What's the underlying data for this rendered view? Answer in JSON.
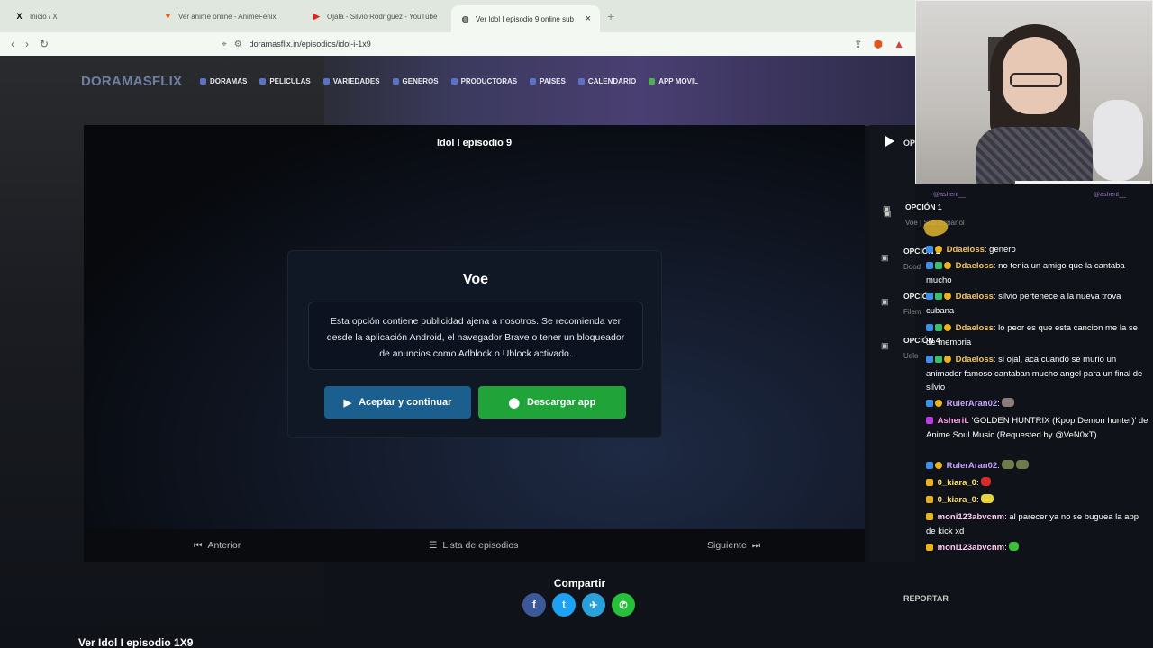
{
  "browser": {
    "tabs": [
      {
        "title": "Inicio / X",
        "icon": "x-logo-icon",
        "fav": "X",
        "favColor": "#000000"
      },
      {
        "title": "Ver anime online - AnimeFénix",
        "icon": "animefenix-icon",
        "fav": "▼",
        "favColor": "#e8601c"
      },
      {
        "title": "Ojalá - Silvio Rodríguez - YouTube",
        "icon": "youtube-icon",
        "fav": "▶",
        "favColor": "#e62117"
      },
      {
        "title": "Ver Idol I episodio 9 online sub",
        "icon": "globe-icon",
        "fav": "◍",
        "favColor": "#555555",
        "active": true
      }
    ],
    "newtab": "+",
    "close": "×",
    "url": "doramasflix.in/episodios/idol-i-1x9"
  },
  "site": {
    "logo": "DORAMASFLIX",
    "nav": [
      "DORAMAS",
      "PELICULAS",
      "VARIEDADES",
      "GENEROS",
      "PRODUCTORAS",
      "PAISES",
      "CALENDARIO",
      "APP MOVIL"
    ],
    "player_title": "Idol I episodio 9",
    "modal": {
      "title": "Voe",
      "text": "Esta opción contiene publicidad ajena a nosotros. Se recomienda ver desde la aplicación Android, el navegador Brave o tener un bloqueador de anuncios como Adblock o Ublock activado.",
      "accept": "Aceptar y continuar",
      "download": "Descargar app"
    },
    "footer": {
      "prev": "Anterior",
      "list": "Lista de episodios",
      "next": "Siguiente"
    },
    "options": [
      {
        "num": "OPCIÓN 1",
        "sub": "Voe | Sub Español"
      },
      {
        "num": "OPCIÓN 2",
        "sub": "Dood"
      },
      {
        "num": "OPCIÓN 3",
        "sub": "Filem"
      },
      {
        "num": "OPCIÓN 4",
        "sub": "Uqlo"
      }
    ],
    "op_label": "OP",
    "report": "REPORTAR",
    "share_title": "Compartir",
    "share": [
      "f",
      "t",
      "✈",
      "✆"
    ],
    "page_heading": "Ver Idol I episodio 1X9"
  },
  "chat": {
    "top_names": [
      "@asherit__",
      "@asherit__"
    ],
    "messages": [
      {
        "user": "Ddaeloss",
        "text": ": genero",
        "color": "ddael"
      },
      {
        "user": "Ddaeloss",
        "text": ": no tenia un amigo que la cantaba mucho",
        "color": "ddael"
      },
      {
        "user": "Ddaeloss",
        "text": ": silvio pertenece a la nueva trova cubana",
        "color": "ddael"
      },
      {
        "user": "Ddaeloss",
        "text": ": lo peor es que esta cancion me la se de memoria",
        "color": "ddael"
      },
      {
        "user": "Ddaeloss",
        "text": ": si ojal, aca cuando se murio un animador famoso cantaban mucho angel para un final de silvio",
        "color": "ddael"
      },
      {
        "user": "RulerAran02",
        "text": ":",
        "color": "ruler"
      },
      {
        "user": "Asherit",
        "text": ": 'GOLDEN HUNTRIX (Kpop Demon hunter)' de Anime Soul Music (Requested by @VeN0xT)",
        "color": "asherit"
      },
      {
        "user": "RulerAran02",
        "text": ":",
        "color": "ruler"
      },
      {
        "user": "0_kiara_0",
        "text": ":",
        "color": "kiara"
      },
      {
        "user": "0_kiara_0",
        "text": ":",
        "color": "kiara"
      },
      {
        "user": "moni123abvcnm",
        "text": ": al parecer ya no se buguea la app de kick xd",
        "color": "moni"
      },
      {
        "user": "moni123abvcnm",
        "text": ":",
        "color": "moni"
      }
    ]
  }
}
